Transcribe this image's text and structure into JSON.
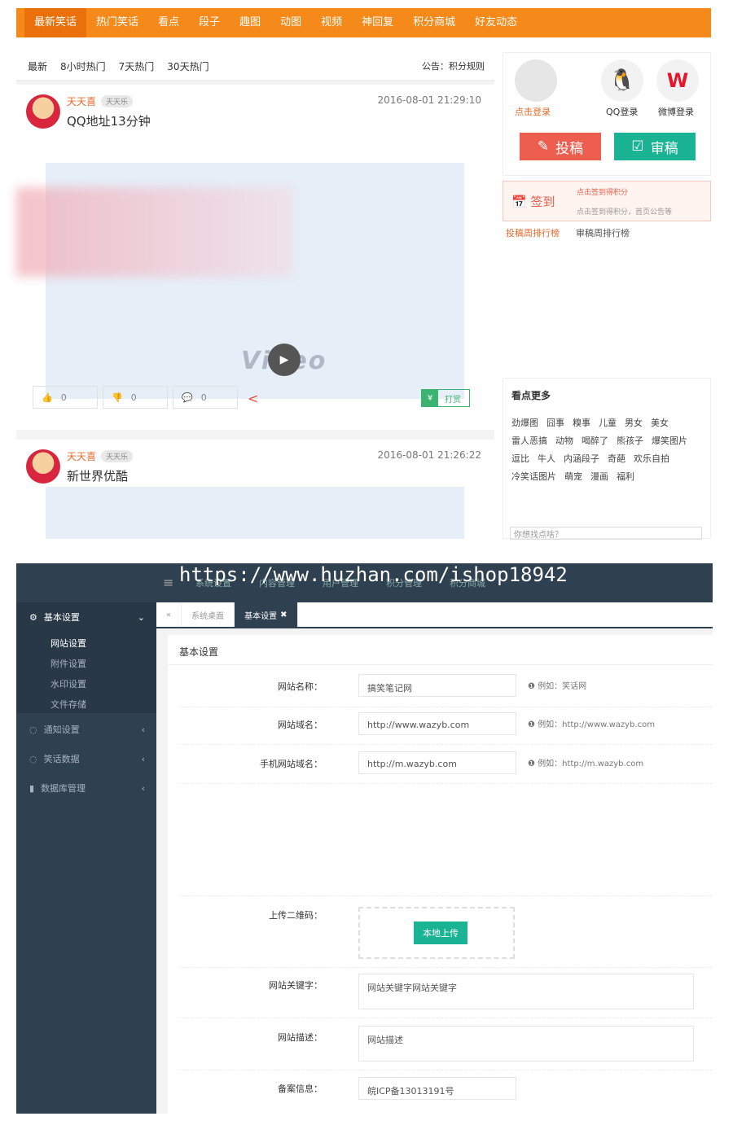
{
  "site": {
    "nav": [
      "最新笑话",
      "热门笑话",
      "看点",
      "段子",
      "趣图",
      "动图",
      "视频",
      "神回复",
      "积分商城",
      "好友动态"
    ],
    "feed_tabs": [
      "最新",
      "8小时热门",
      "7天热门",
      "30天热门"
    ],
    "notice": "公告：积分规则",
    "posts": [
      {
        "user": "天天喜",
        "level": "天天乐",
        "title": "QQ地址13分钟",
        "time": "2016-08-01 21:29:10",
        "likes": "0",
        "dislikes": "0",
        "comments": "0",
        "video_text": "Video"
      },
      {
        "user": "天天喜",
        "level": "天天乐",
        "title": "新世界优酷",
        "time": "2016-08-01 21:26:22"
      }
    ],
    "tip_label": "打赏",
    "login": {
      "click_login": "点击登录",
      "qq_login": "QQ登录",
      "weibo_login": "微博登录"
    },
    "buttons": {
      "submit": "投稿",
      "review": "审稿"
    },
    "sign": {
      "label": "签到",
      "tip1": "点击签到得积分",
      "tip2": "点击签到得积分，首页公告等"
    },
    "rank_tabs": [
      "投稿周排行榜",
      "审稿周排行榜"
    ],
    "tags_title": "看点更多",
    "tags": [
      "劲爆图",
      "囧事",
      "糗事",
      "儿童",
      "男女",
      "美女",
      "雷人恶搞",
      "动物",
      "喝醉了",
      "熊孩子",
      "爆笑图片",
      "逗比",
      "牛人",
      "内涵段子",
      "奇葩",
      "欢乐自拍",
      "冷笑话图片",
      "萌宠",
      "漫画",
      "福利"
    ],
    "search_placeholder": "你想找点啥？"
  },
  "admin": {
    "watermark": "https://www.huzhan.com/ishop18942",
    "header_links": [
      "系统设置",
      "内容管理",
      "用户管理",
      "积分管理",
      "积分商城"
    ],
    "sidebar": {
      "groups": [
        "基本设置",
        "通知设置",
        "笑话数据",
        "数据库管理"
      ],
      "subs": [
        "网站设置",
        "附件设置",
        "水印设置",
        "文件存储"
      ]
    },
    "tabs": [
      "系统桌面",
      "基本设置"
    ],
    "form_title": "基本设置",
    "fields": {
      "site_name_label": "网站名称：",
      "site_name_value": "搞笑笔记网",
      "site_name_hint": "例如：笑话网",
      "domain_label": "网站域名：",
      "domain_value": "http://www.wazyb.com",
      "domain_hint": "例如：http://www.wazyb.com",
      "mdomain_label": "手机网站域名：",
      "mdomain_value": "http://m.wazyb.com",
      "mdomain_hint": "例如：http://m.wazyb.com",
      "qr_label": "上传二维码：",
      "upload_btn": "本地上传",
      "keywords_label": "网站关键字：",
      "keywords_value": "网站关键字网站关键字",
      "desc_label": "网站描述：",
      "desc_value": "网站描述",
      "icp_label": "备案信息：",
      "icp_value": "皖ICP备13013191号"
    }
  },
  "colors": {
    "orange": "#f5891a",
    "sidebar": "#2f4050",
    "red_btn": "#ed5e4e",
    "green_btn": "#1ab394"
  }
}
